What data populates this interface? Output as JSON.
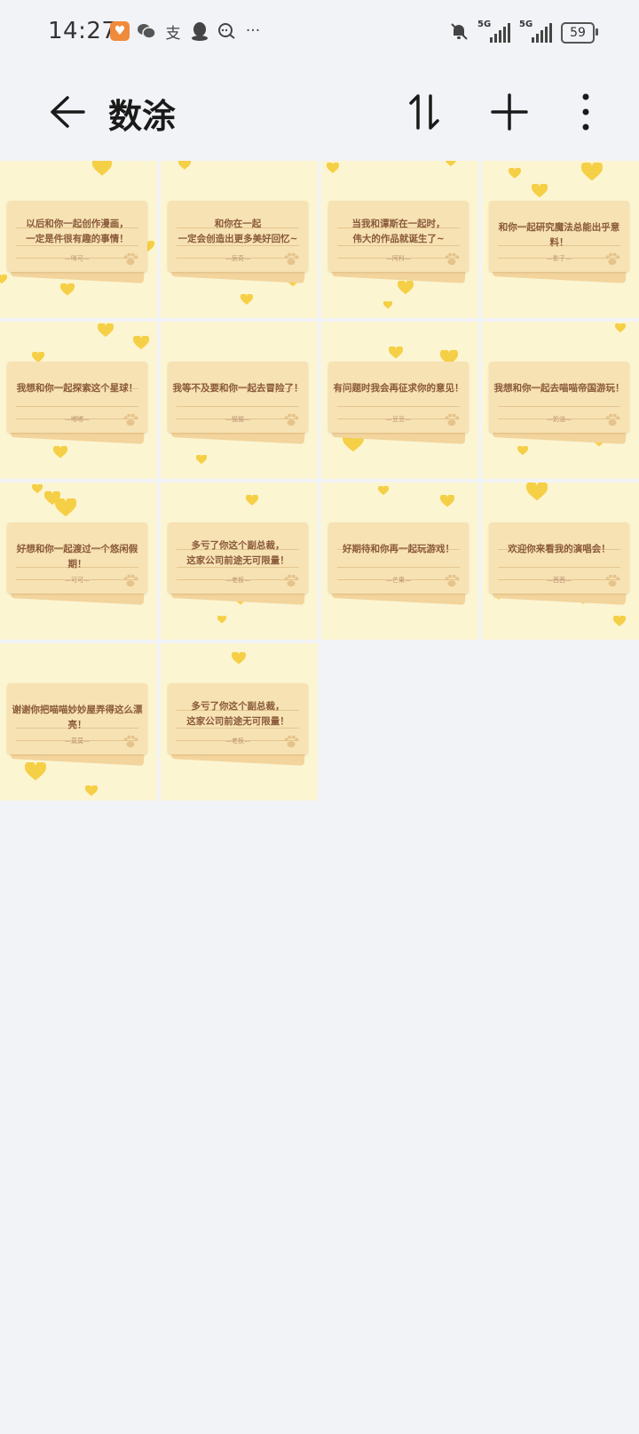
{
  "status_bar": {
    "time": "14:27",
    "left_icons": [
      "app-shield-icon",
      "wechat-icon",
      "alipay-icon",
      "qq-icon",
      "chat-bubble-icon",
      "more-dots-icon"
    ],
    "network_1": "5G",
    "network_2": "5G",
    "battery": "59"
  },
  "app_bar": {
    "title": "数涂",
    "back_icon": "arrow-left-icon",
    "sort_icon": "sort-icon",
    "add_icon": "plus-icon",
    "more_icon": "more-vertical-icon"
  },
  "colors": {
    "tile_bg": "#fcf5d2",
    "heart": "#f5cf45",
    "card": "#f7e2b3",
    "text": "#8a5a3a"
  },
  "tiles": [
    {
      "text": "以后和你一起创作漫画，\n一定是件很有趣的事情！",
      "sign": "—咪可—"
    },
    {
      "text": "和你在一起\n一定会创造出更多美好回忆~",
      "sign": "—辰奇—"
    },
    {
      "text": "当我和谭斯在一起时，\n伟大的作品就诞生了~",
      "sign": "—阿科—"
    },
    {
      "text": "和你一起研究魔法总能出乎意料！",
      "sign": "—影子—"
    },
    {
      "text": "我想和你一起探索这个星球！",
      "sign": "—嘟嘟—"
    },
    {
      "text": "我等不及要和你一起去冒险了！",
      "sign": "—猫猫—"
    },
    {
      "text": "有问题时我会再征求你的意见！",
      "sign": "—豆豆—"
    },
    {
      "text": "我想和你一起去喵喵帝国游玩！",
      "sign": "—奶油—"
    },
    {
      "text": "好想和你一起渡过一个悠闲假期！",
      "sign": "—可可—"
    },
    {
      "text": "多亏了你这个副总裁，\n这家公司前途无可限量！",
      "sign": "—老板—"
    },
    {
      "text": "好期待和你再一起玩游戏！",
      "sign": "—芒果—"
    },
    {
      "text": "欢迎你来看我的演唱会！",
      "sign": "—茜茜—"
    },
    {
      "text": "谢谢你把喵喵妙妙屋弄得这么漂亮！",
      "sign": "—莫莫—"
    },
    {
      "text": "多亏了你这个副总裁，\n这家公司前途无可限量！",
      "sign": "—老板—"
    }
  ]
}
